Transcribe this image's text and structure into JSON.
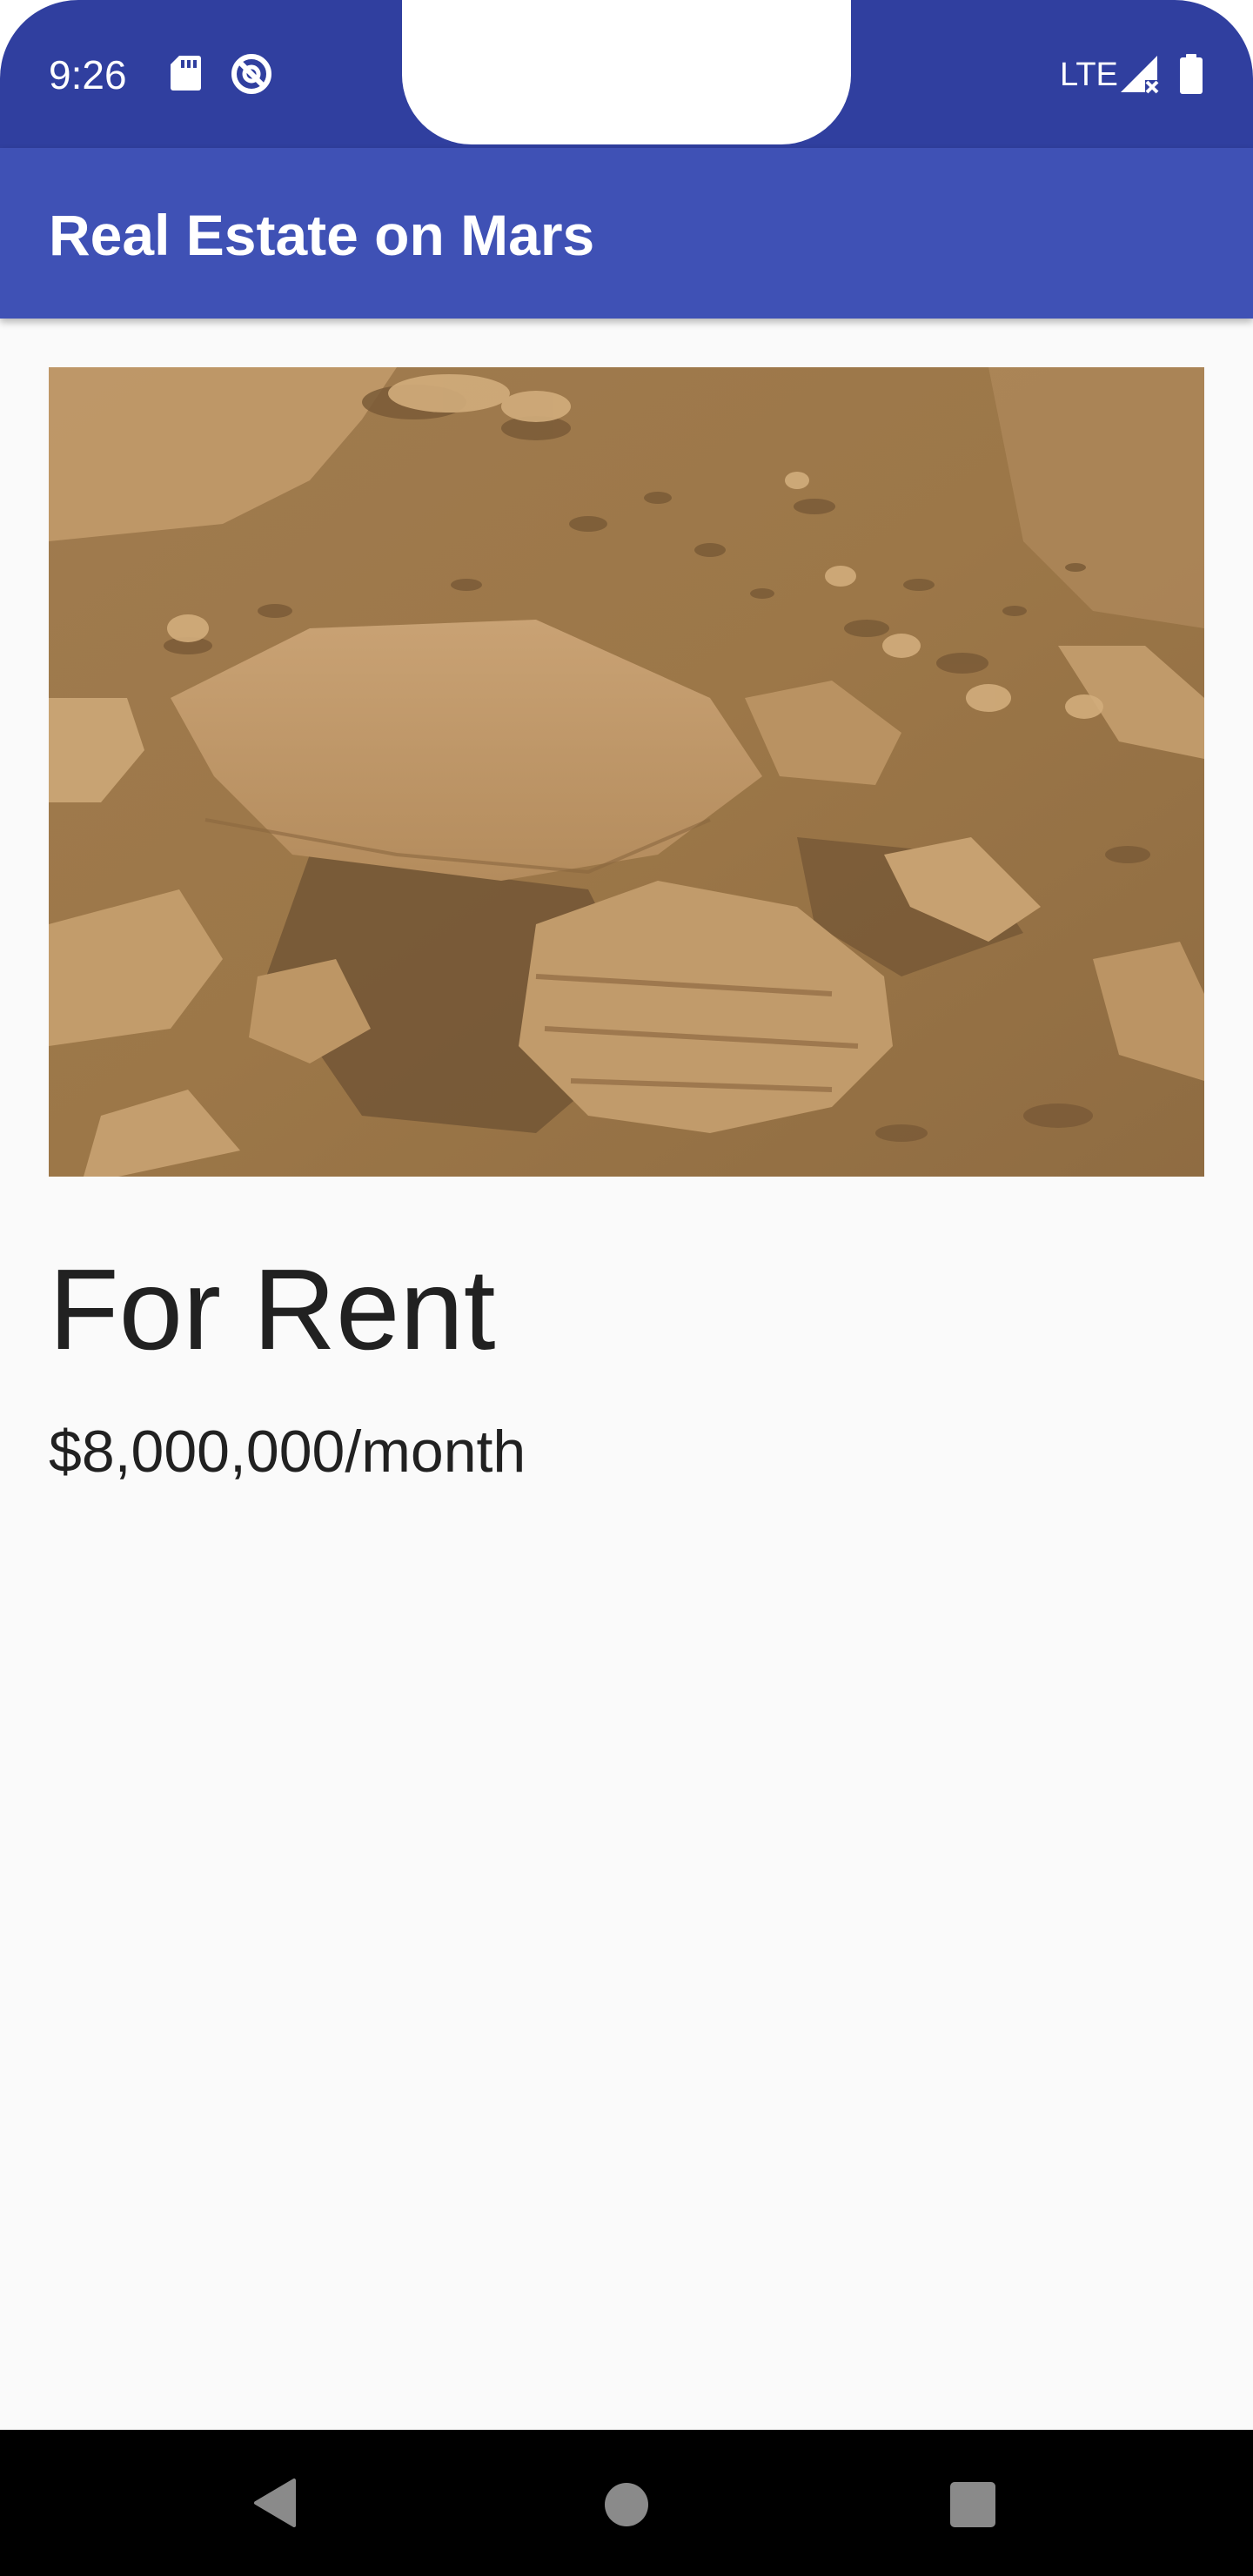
{
  "status_bar": {
    "time": "9:26",
    "network": "LTE",
    "icons": [
      "sd-card-icon",
      "sync-icon",
      "signal-icon",
      "battery-icon"
    ]
  },
  "app_bar": {
    "title": "Real Estate on Mars",
    "color": "#3f51b5",
    "status_color": "#303f9f"
  },
  "listing": {
    "photo_icon": "mars-surface-photo",
    "type": "For Rent",
    "price": "$8,000,000/month"
  },
  "nav_bar": {
    "icons": [
      "back-icon",
      "home-icon",
      "recents-icon"
    ]
  }
}
